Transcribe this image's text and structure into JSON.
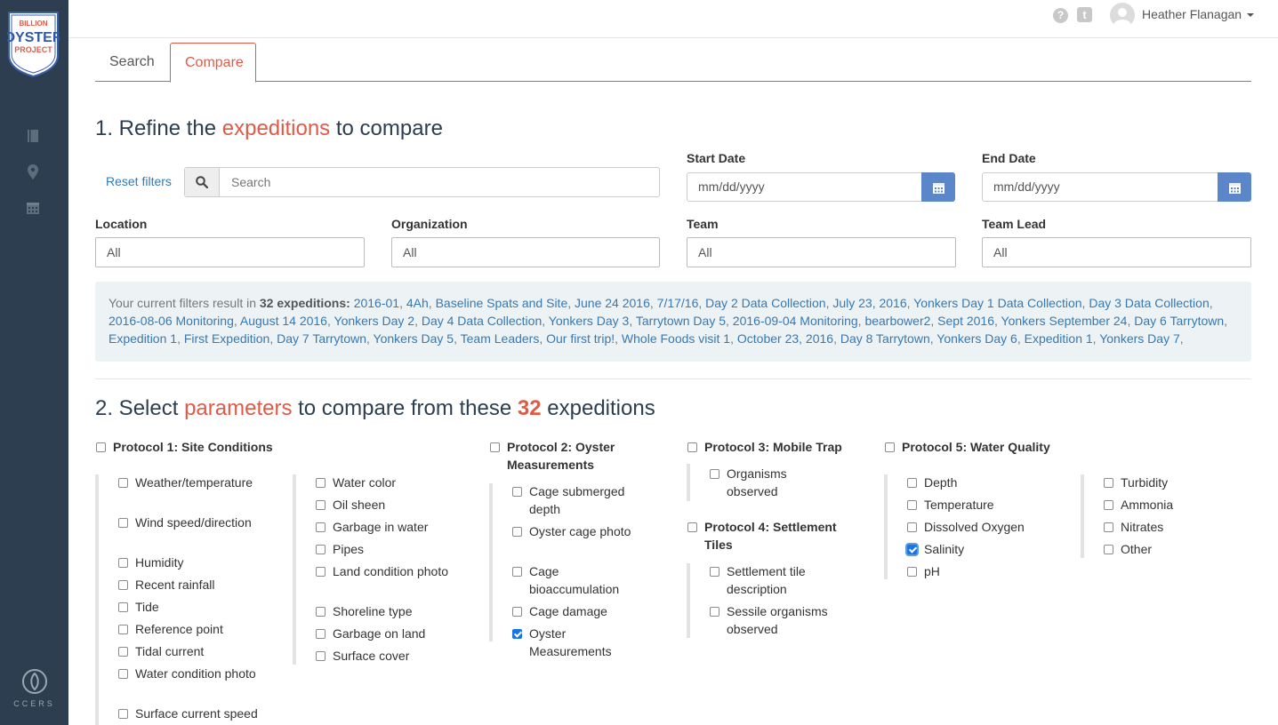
{
  "sidebar": {
    "logo": {
      "line1": "BILLION",
      "line2": "OYSTER",
      "line3": "PROJECT"
    },
    "icons": [
      "book-icon",
      "map-marker-icon",
      "calendar-icon"
    ],
    "footer_label": "CCERS"
  },
  "header": {
    "user_name": "Heather Flanagan",
    "help_glyph": "?",
    "tumblr_glyph": "t"
  },
  "tabs": [
    {
      "label": "Search",
      "active": false
    },
    {
      "label": "Compare",
      "active": true
    }
  ],
  "section1": {
    "prefix": "1. Refine the ",
    "highlight": "expeditions",
    "suffix": " to compare"
  },
  "filters": {
    "reset_label": "Reset filters",
    "search_placeholder": "Search",
    "start_date_label": "Start Date",
    "start_date_placeholder": "mm/dd/yyyy",
    "end_date_label": "End Date",
    "end_date_placeholder": "mm/dd/yyyy",
    "location_label": "Location",
    "location_value": "All",
    "organization_label": "Organization",
    "organization_value": "All",
    "team_label": "Team",
    "team_value": "All",
    "team_lead_label": "Team Lead",
    "team_lead_value": "All"
  },
  "results": {
    "intro": "Your current filters result in ",
    "count_text": "32 expeditions:",
    "expeditions": [
      "2016-01",
      "4Ah",
      "Baseline Spats and Site",
      "June 24 2016",
      "7/17/16",
      "Day 2 Data Collection",
      "July 23, 2016",
      "Yonkers Day 1 Data Collection",
      "Day 3 Data Collection",
      "2016-08-06 Monitoring",
      "August 14 2016",
      "Yonkers Day 2",
      "Day 4 Data Collection",
      "Yonkers Day 3",
      "Tarrytown Day 5",
      "2016-09-04 Monitoring",
      "bearbower2",
      "Sept 2016",
      "Yonkers September 24",
      "Day 6 Tarrytown",
      "Expedition 1",
      "First Expedition",
      "Day 7 Tarrytown",
      "Yonkers Day 5",
      "Team Leaders",
      "Our first trip!",
      "Whole Foods visit 1",
      "October 23, 2016",
      "Day 8 Tarrytown",
      "Yonkers Day 6",
      "Expedition 1",
      "Yonkers Day 7"
    ]
  },
  "section2": {
    "prefix": "2. Select ",
    "highlight": "parameters",
    "middle": " to compare from these ",
    "count": "32",
    "suffix": " expeditions"
  },
  "protocols": {
    "p1": {
      "title": "Protocol 1: Site Conditions",
      "col1": [
        "Weather/temperature",
        "Wind speed/direction",
        "Humidity",
        "Recent rainfall",
        "Tide",
        "Reference point",
        "Tidal current",
        "Water condition photo",
        "Surface current speed"
      ],
      "col2": [
        "Water color",
        "Oil sheen",
        "Garbage in water",
        "Pipes",
        "Land condition photo",
        "Shoreline type",
        "Garbage on land",
        "Surface cover"
      ]
    },
    "p2": {
      "title": "Protocol 2: Oyster Measurements",
      "items": [
        "Cage submerged depth",
        "Oyster cage photo",
        "Cage bioaccumulation",
        "Cage damage",
        "Oyster Measurements"
      ],
      "checked": [
        "Oyster Measurements"
      ]
    },
    "p3": {
      "title": "Protocol 3: Mobile Trap",
      "items": [
        "Organisms observed"
      ]
    },
    "p4": {
      "title": "Protocol 4: Settlement Tiles",
      "items": [
        "Settlement tile description",
        "Sessile organisms observed"
      ]
    },
    "p5": {
      "title": "Protocol 5: Water Quality",
      "col1": [
        "Depth",
        "Temperature",
        "Dissolved Oxygen",
        "Salinity",
        "pH"
      ],
      "col2": [
        "Turbidity",
        "Ammonia",
        "Nitrates",
        "Other"
      ],
      "checked": [
        "Salinity"
      ]
    }
  },
  "colors": {
    "accent": "#e05a47",
    "sidebar": "#2d3e50",
    "link": "#337ab7",
    "calendar_button": "#5b86c9"
  }
}
